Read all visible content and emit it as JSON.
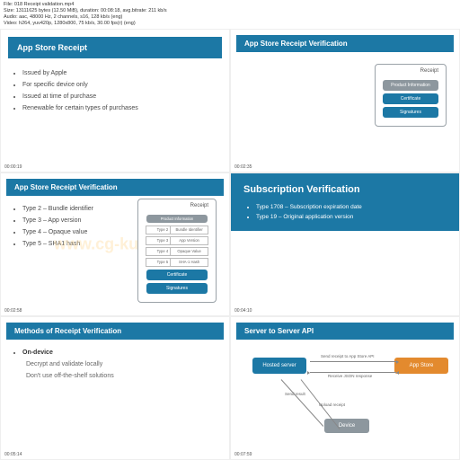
{
  "meta": {
    "l1": "File: 018 Receipt validation.mp4",
    "l2": "Size: 13111625 bytes (12.50 MiB), duration: 00:08:18, avg.bitrate: 211 kb/s",
    "l3": "Audio: aac, 48000 Hz, 2 channels, s16, 128 kb/s (eng)",
    "l4": "Video: h264, yuv420p, 1280x800, 75 kb/s, 30.00 fps(r) (eng)"
  },
  "watermark": "www.cg-ku.com",
  "slides": {
    "s1": {
      "title": "App Store Receipt",
      "bullets": [
        "Issued by Apple",
        "For specific device only",
        "Issued at time of purchase",
        "Renewable for certain types of purchases"
      ],
      "ts": "00:00:19"
    },
    "s2": {
      "title": "App Store Receipt Verification",
      "receipt": {
        "label": "Receipt",
        "grey": "Product Information",
        "blue1": "Certificate",
        "blue2": "Signatures"
      },
      "ts": "00:02:35"
    },
    "s3": {
      "title": "App Store Receipt Verification",
      "bullets": [
        "Type 2 – Bundle identifier",
        "Type 3 – App version",
        "Type 4 – Opaque value",
        "Type 5 – SHA1 hash"
      ],
      "receipt": {
        "label": "Receipt",
        "greyPill": "Product Information",
        "rows": [
          {
            "k": "Type 2",
            "v": "Bundle Identifier"
          },
          {
            "k": "Type 3",
            "v": "App Version"
          },
          {
            "k": "Type 4",
            "v": "Opaque Value"
          },
          {
            "k": "Type 5",
            "v": "SHA-1 Hash"
          }
        ],
        "blue1": "Certificate",
        "blue2": "Signatures"
      },
      "ts": "00:02:58"
    },
    "s4": {
      "title": "Subscription Verification",
      "bullets": [
        "Type 1708 – Subscription expiration date",
        "Type 19 – Original application version"
      ],
      "ts": "00:04:10"
    },
    "s5": {
      "title": "Methods of Receipt Verification",
      "item": "On-device",
      "sub": [
        "Decrypt and validate locally",
        "Don't use off-the-shelf solutions"
      ],
      "ts": "00:05:14"
    },
    "s6": {
      "title": "Server to Server API",
      "nodes": {
        "host": "Hosted server",
        "app": "App Store",
        "dev": "Device"
      },
      "labels": {
        "send": "Send receipt to App Store API",
        "recv": "Receive JSON response",
        "down": "Send result",
        "up": "Upload receipt"
      },
      "ts": "00:07:59"
    }
  }
}
